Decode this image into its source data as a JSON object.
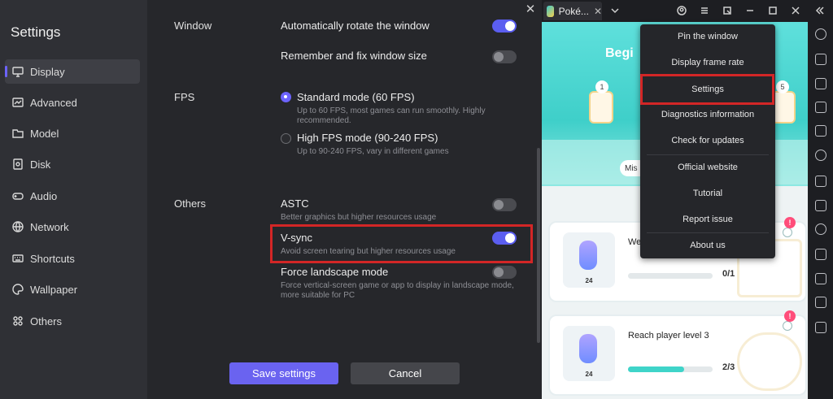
{
  "settings": {
    "title": "Settings",
    "nav": [
      {
        "label": "Display",
        "icon": "monitor-icon"
      },
      {
        "label": "Advanced",
        "icon": "chart-icon"
      },
      {
        "label": "Model",
        "icon": "folder-icon"
      },
      {
        "label": "Disk",
        "icon": "disk-icon"
      },
      {
        "label": "Audio",
        "icon": "gamepad-icon"
      },
      {
        "label": "Network",
        "icon": "globe-icon"
      },
      {
        "label": "Shortcuts",
        "icon": "keyboard-icon"
      },
      {
        "label": "Wallpaper",
        "icon": "palette-icon"
      },
      {
        "label": "Others",
        "icon": "grid-icon"
      }
    ],
    "active_nav": "Display",
    "window": {
      "label": "Window",
      "auto_rotate": {
        "title": "Automatically rotate the window",
        "enabled": true
      },
      "remember_size": {
        "title": "Remember and fix window size",
        "enabled": false
      }
    },
    "fps": {
      "label": "FPS",
      "standard": {
        "title": "Standard mode (60 FPS)",
        "desc": "Up to 60 FPS, most games can run smoothly. Highly recommended.",
        "selected": true
      },
      "high": {
        "title": "High FPS mode (90-240 FPS)",
        "desc": "Up to 90-240 FPS, vary in different games",
        "selected": false
      }
    },
    "others": {
      "label": "Others",
      "astc": {
        "title": "ASTC",
        "desc": "Better graphics but higher resources usage",
        "enabled": false
      },
      "vsync": {
        "title": "V-sync",
        "desc": "Avoid screen tearing but higher resources usage",
        "enabled": true
      },
      "landscape": {
        "title": "Force landscape mode",
        "desc": "Force vertical-screen game or app to display in landscape mode, more suitable for PC",
        "enabled": false
      }
    },
    "buttons": {
      "save": "Save settings",
      "cancel": "Cancel"
    },
    "close_glyph": "✕"
  },
  "emulator": {
    "tab_title": "Poké...",
    "tab_close": "✕",
    "game": {
      "banner_text": "Begi",
      "mission_pill": "Mis",
      "tile_nums": [
        "1",
        "5"
      ],
      "tasks": [
        {
          "text": "We",
          "level": "24",
          "progress": "0/1",
          "fraction": 0
        },
        {
          "text": "Reach player level 3",
          "level": "24",
          "progress": "2/3",
          "fraction": 0.667
        }
      ],
      "alert": "!"
    }
  },
  "menu": {
    "items": [
      "Pin the window",
      "Display frame rate",
      "Settings",
      "Diagnostics information",
      "Check for updates",
      "Official website",
      "Tutorial",
      "Report issue",
      "About us"
    ]
  },
  "colors": {
    "accent": "#6a63f0",
    "highlight": "#d32626",
    "teal": "#3fd4c9"
  }
}
